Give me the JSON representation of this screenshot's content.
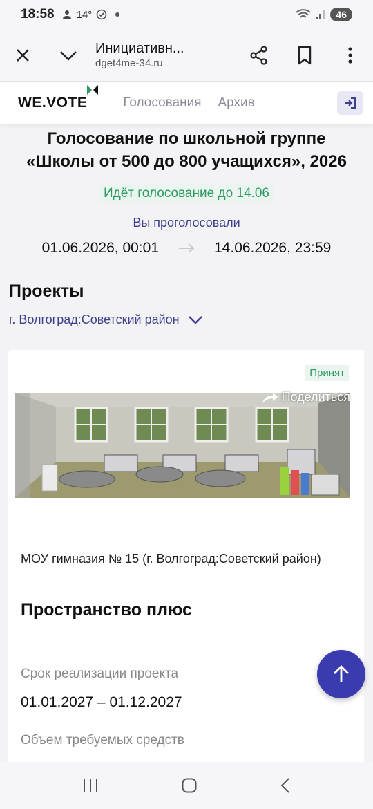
{
  "status_bar": {
    "time": "18:58",
    "temperature": "14°",
    "battery": "46"
  },
  "browser": {
    "title": "Инициативн...",
    "url": "dget4me-34.ru"
  },
  "site": {
    "logo": "WE.VOTE",
    "nav": [
      "Голосования",
      "Архив"
    ]
  },
  "voting": {
    "title": "Голосование по школьной группе «Школы от 500 до 800 учащихся», 2026",
    "status": "Идёт голосование до 14.06",
    "voted": "Вы проголосовали",
    "start": "01.06.2026, 00:01",
    "end": "14.06.2026, 23:59"
  },
  "projects": {
    "heading": "Проекты",
    "district": "г. Волгоград:Советский район",
    "card": {
      "badge": "Принят",
      "share": "Поделиться",
      "school": "МОУ гимназия № 15 (г. Волгоград:Советский район)",
      "name": "Пространство плюс",
      "period_label": "Срок реализации проекта",
      "period_value": "01.01.2027 – 01.12.2027",
      "funds_label": "Объем требуемых средств"
    }
  },
  "colors": {
    "accent": "#3b3bb0",
    "green": "#2e9a63",
    "nav_text": "#3f3f8f"
  },
  "icons": [
    "close-icon",
    "chevron-down-icon",
    "share-icon",
    "bookmark-icon",
    "more-icon",
    "logout-icon",
    "arrow-right-icon",
    "arrow-up-icon"
  ]
}
